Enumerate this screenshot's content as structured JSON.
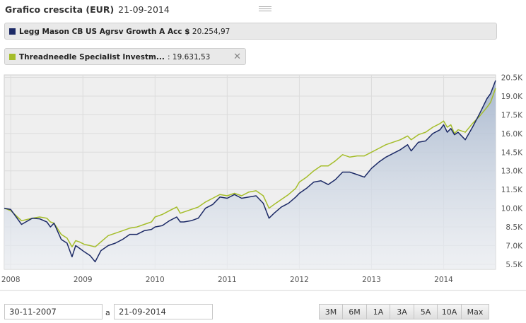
{
  "header": {
    "title": "Grafico crescita (EUR)",
    "date": "21-09-2014"
  },
  "legend": [
    {
      "name": "Legg Mason CB US Agrsv Growth A Acc $",
      "value": "20.254,97",
      "color": "#1c2a66",
      "closable": false
    },
    {
      "name": "Threadneedle Specialist Investm...",
      "value": "19.631,53",
      "color": "#a5bd2a",
      "closable": true,
      "close_icon": "close-icon"
    }
  ],
  "chart_data": {
    "type": "line",
    "x_tick_labels": [
      "2008",
      "2009",
      "2010",
      "2011",
      "2012",
      "2013",
      "2014"
    ],
    "y_tick_labels": [
      "5.5K",
      "7.0K",
      "8.5K",
      "10.0K",
      "11.5K",
      "13.0K",
      "14.5K",
      "16.0K",
      "17.5K",
      "19.0K",
      "20.5K"
    ],
    "xlim": [
      2007.91,
      2014.72
    ],
    "ylim": [
      5100,
      20700
    ],
    "grid": true,
    "area_under_first_series": true,
    "series": [
      {
        "name": "Legg Mason CB US Agrsv Growth A Acc $",
        "color": "#1c2a66",
        "points": [
          [
            2007.91,
            10000
          ],
          [
            2008.0,
            9900
          ],
          [
            2008.15,
            8700
          ],
          [
            2008.3,
            9200
          ],
          [
            2008.4,
            9150
          ],
          [
            2008.5,
            8900
          ],
          [
            2008.55,
            8500
          ],
          [
            2008.6,
            8800
          ],
          [
            2008.7,
            7500
          ],
          [
            2008.78,
            7200
          ],
          [
            2008.85,
            6100
          ],
          [
            2008.9,
            7000
          ],
          [
            2008.95,
            6800
          ],
          [
            2009.02,
            6500
          ],
          [
            2009.1,
            6200
          ],
          [
            2009.17,
            5700
          ],
          [
            2009.25,
            6600
          ],
          [
            2009.35,
            7000
          ],
          [
            2009.45,
            7200
          ],
          [
            2009.55,
            7500
          ],
          [
            2009.65,
            7900
          ],
          [
            2009.75,
            7900
          ],
          [
            2009.85,
            8200
          ],
          [
            2009.95,
            8300
          ],
          [
            2010.0,
            8500
          ],
          [
            2010.1,
            8600
          ],
          [
            2010.2,
            9000
          ],
          [
            2010.3,
            9300
          ],
          [
            2010.35,
            8900
          ],
          [
            2010.4,
            8900
          ],
          [
            2010.5,
            9000
          ],
          [
            2010.6,
            9200
          ],
          [
            2010.7,
            10000
          ],
          [
            2010.8,
            10300
          ],
          [
            2010.9,
            10900
          ],
          [
            2011.0,
            10800
          ],
          [
            2011.1,
            11100
          ],
          [
            2011.2,
            10800
          ],
          [
            2011.3,
            10900
          ],
          [
            2011.4,
            11000
          ],
          [
            2011.5,
            10400
          ],
          [
            2011.58,
            9200
          ],
          [
            2011.65,
            9600
          ],
          [
            2011.75,
            10100
          ],
          [
            2011.85,
            10400
          ],
          [
            2011.95,
            10900
          ],
          [
            2012.0,
            11200
          ],
          [
            2012.1,
            11600
          ],
          [
            2012.2,
            12100
          ],
          [
            2012.3,
            12200
          ],
          [
            2012.4,
            11900
          ],
          [
            2012.5,
            12300
          ],
          [
            2012.6,
            12900
          ],
          [
            2012.7,
            12900
          ],
          [
            2012.8,
            12700
          ],
          [
            2012.9,
            12500
          ],
          [
            2013.0,
            13200
          ],
          [
            2013.1,
            13700
          ],
          [
            2013.2,
            14100
          ],
          [
            2013.3,
            14400
          ],
          [
            2013.4,
            14700
          ],
          [
            2013.5,
            15100
          ],
          [
            2013.55,
            14600
          ],
          [
            2013.65,
            15300
          ],
          [
            2013.75,
            15400
          ],
          [
            2013.85,
            16000
          ],
          [
            2013.95,
            16300
          ],
          [
            2014.0,
            16700
          ],
          [
            2014.05,
            16100
          ],
          [
            2014.1,
            16400
          ],
          [
            2014.15,
            15900
          ],
          [
            2014.2,
            16100
          ],
          [
            2014.3,
            15500
          ],
          [
            2014.4,
            16500
          ],
          [
            2014.5,
            17600
          ],
          [
            2014.6,
            18800
          ],
          [
            2014.65,
            19200
          ],
          [
            2014.72,
            20250
          ]
        ]
      },
      {
        "name": "Threadneedle Specialist Investm...",
        "color": "#a5bd2a",
        "points": [
          [
            2007.91,
            10000
          ],
          [
            2008.0,
            9800
          ],
          [
            2008.15,
            9000
          ],
          [
            2008.3,
            9200
          ],
          [
            2008.4,
            9300
          ],
          [
            2008.5,
            9200
          ],
          [
            2008.55,
            8900
          ],
          [
            2008.6,
            8800
          ],
          [
            2008.7,
            7900
          ],
          [
            2008.78,
            7600
          ],
          [
            2008.85,
            6900
          ],
          [
            2008.9,
            7400
          ],
          [
            2008.95,
            7300
          ],
          [
            2009.02,
            7100
          ],
          [
            2009.1,
            7000
          ],
          [
            2009.17,
            6900
          ],
          [
            2009.25,
            7300
          ],
          [
            2009.35,
            7800
          ],
          [
            2009.45,
            8000
          ],
          [
            2009.55,
            8200
          ],
          [
            2009.65,
            8400
          ],
          [
            2009.75,
            8500
          ],
          [
            2009.85,
            8700
          ],
          [
            2009.95,
            8900
          ],
          [
            2010.0,
            9300
          ],
          [
            2010.1,
            9500
          ],
          [
            2010.2,
            9800
          ],
          [
            2010.3,
            10100
          ],
          [
            2010.35,
            9600
          ],
          [
            2010.4,
            9700
          ],
          [
            2010.5,
            9900
          ],
          [
            2010.6,
            10100
          ],
          [
            2010.7,
            10500
          ],
          [
            2010.8,
            10800
          ],
          [
            2010.9,
            11100
          ],
          [
            2011.0,
            11000
          ],
          [
            2011.1,
            11200
          ],
          [
            2011.2,
            11000
          ],
          [
            2011.3,
            11300
          ],
          [
            2011.4,
            11400
          ],
          [
            2011.5,
            11000
          ],
          [
            2011.58,
            10000
          ],
          [
            2011.65,
            10300
          ],
          [
            2011.75,
            10700
          ],
          [
            2011.85,
            11100
          ],
          [
            2011.95,
            11600
          ],
          [
            2012.0,
            12100
          ],
          [
            2012.1,
            12500
          ],
          [
            2012.2,
            13000
          ],
          [
            2012.3,
            13400
          ],
          [
            2012.4,
            13400
          ],
          [
            2012.5,
            13800
          ],
          [
            2012.6,
            14300
          ],
          [
            2012.7,
            14100
          ],
          [
            2012.8,
            14200
          ],
          [
            2012.9,
            14200
          ],
          [
            2013.0,
            14500
          ],
          [
            2013.1,
            14800
          ],
          [
            2013.2,
            15100
          ],
          [
            2013.3,
            15300
          ],
          [
            2013.4,
            15500
          ],
          [
            2013.5,
            15800
          ],
          [
            2013.55,
            15500
          ],
          [
            2013.65,
            15900
          ],
          [
            2013.75,
            16100
          ],
          [
            2013.85,
            16500
          ],
          [
            2013.95,
            16800
          ],
          [
            2014.0,
            17000
          ],
          [
            2014.05,
            16500
          ],
          [
            2014.1,
            16700
          ],
          [
            2014.15,
            16000
          ],
          [
            2014.2,
            16300
          ],
          [
            2014.3,
            16100
          ],
          [
            2014.4,
            16800
          ],
          [
            2014.5,
            17400
          ],
          [
            2014.6,
            18100
          ],
          [
            2014.65,
            18500
          ],
          [
            2014.72,
            19630
          ]
        ]
      }
    ]
  },
  "controls": {
    "from_date": "30-11-2007",
    "separator": "a",
    "to_date": "21-09-2014",
    "ranges": [
      "3M",
      "6M",
      "1A",
      "3A",
      "5A",
      "10A",
      "Max"
    ]
  }
}
